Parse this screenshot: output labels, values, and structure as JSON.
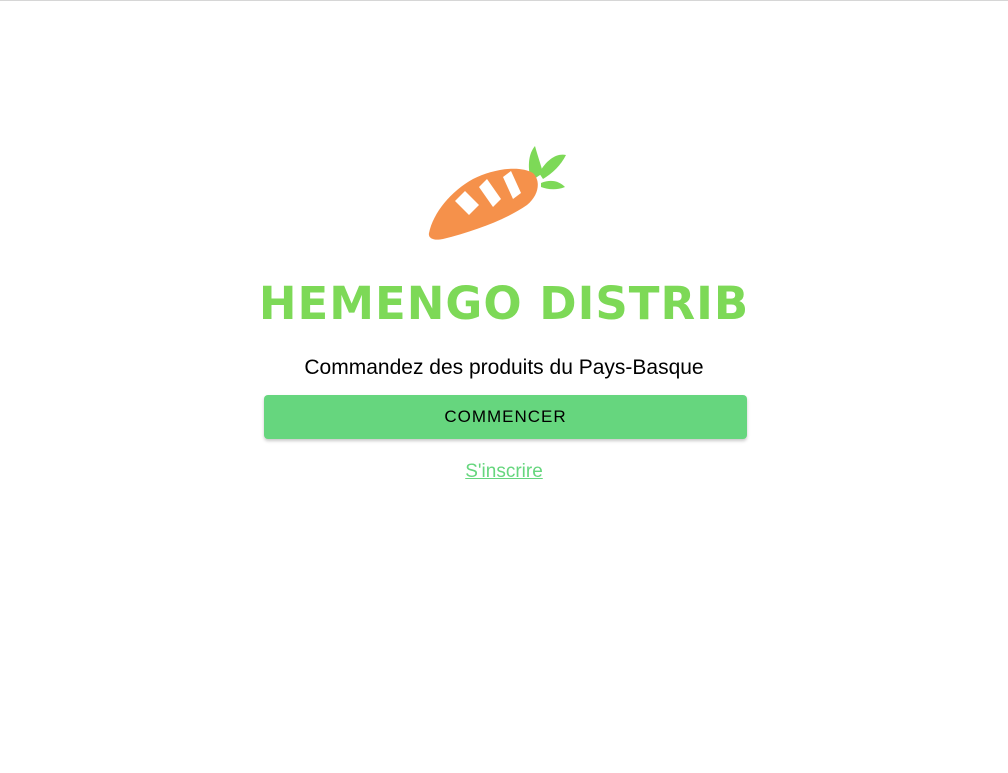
{
  "brand": {
    "name": "HEMENGO DISTRIB",
    "logo_icon": "carrot-icon",
    "color": "#7dd957"
  },
  "tagline": "Commandez des produits du Pays-Basque",
  "actions": {
    "start_label": "COMMENCER",
    "signup_label": "S'inscrire",
    "accent_color": "#66d67e"
  },
  "colors": {
    "carrot": "#f5914b",
    "leaves": "#7dd957"
  }
}
